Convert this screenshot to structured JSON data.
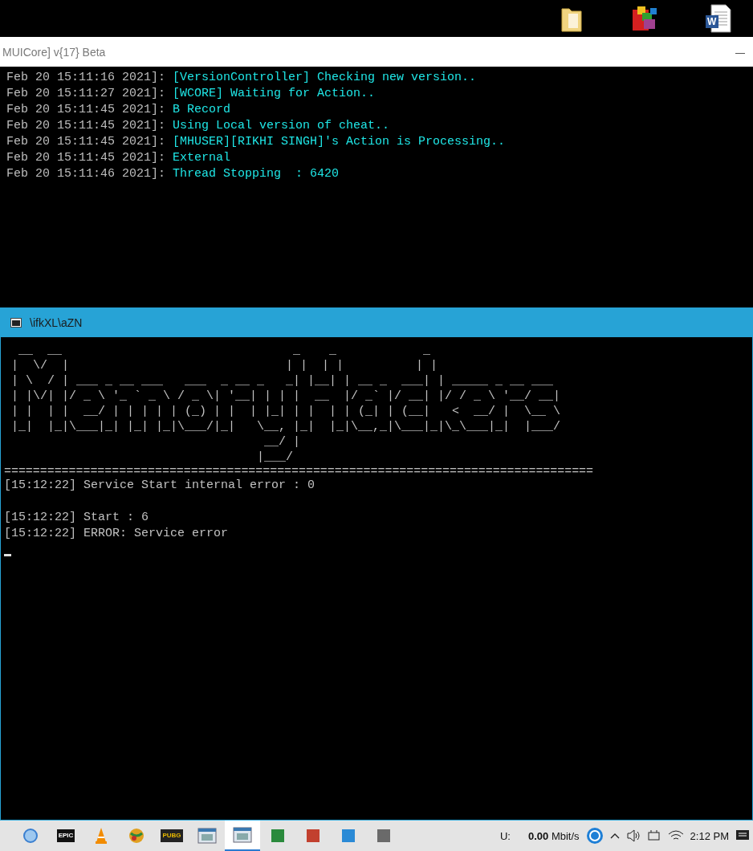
{
  "desktop_icons": [
    {
      "kind": "folder"
    },
    {
      "kind": "archive"
    },
    {
      "kind": "document",
      "letter": "W"
    }
  ],
  "log_window": {
    "title": "MUICore] v{17} Beta",
    "lines": [
      {
        "time": "Feb 20 15:11:16 2021]: ",
        "message": "[VersionController] Checking new version.."
      },
      {
        "time": "Feb 20 15:11:27 2021]: ",
        "message": "[WCORE] Waiting for Action.."
      },
      {
        "time": "Feb 20 15:11:45 2021]: ",
        "message": "B Record"
      },
      {
        "time": "Feb 20 15:11:45 2021]: ",
        "message": "Using Local version of cheat.."
      },
      {
        "time": "Feb 20 15:11:45 2021]: ",
        "message": "[MHUSER][RIKHI SINGH]'s Action is Processing.."
      },
      {
        "time": "Feb 20 15:11:45 2021]: ",
        "message": "External"
      },
      {
        "time": "Feb 20 15:11:46 2021]: ",
        "message": "Thread Stopping  : 6420"
      }
    ]
  },
  "console_window": {
    "title": "\\ifkXL\\aZN",
    "banner": [
      " __  __                                _    _            _",
      "|  \\/  |                              | |  | |          | |",
      "| \\  / | ___ _ __ ___   ___  _ __ _   _| |__| | __ _  ___| | _____ _ __ ___",
      "| |\\/| |/ _ \\ '_ ` _ \\ / _ \\| '__| | | |  __  |/ _` |/ __| |/ / _ \\ '__/ __|",
      "| |  | |  __/ | | | | | (_) | |  | |_| | |  | | (_| | (__|   <  __/ |  \\__ \\",
      "|_|  |_|\\___|_| |_| |_|\\___/|_|   \\__, |_|  |_|\\__,_|\\___|_|\\_\\___|_|  |___/",
      "                                   __/ |",
      "                                  |___/"
    ],
    "separator": "==================================================================================",
    "output_blocks": [
      [
        "[15:12:22] Service Start internal error : 0"
      ],
      [
        "[15:12:22] Start : 6",
        "[15:12:22] ERROR: Service error"
      ]
    ]
  },
  "taskbar": {
    "items": [
      {
        "kind": "circle",
        "selected": false
      },
      {
        "kind": "logo",
        "label": "EPIC",
        "selected": false
      },
      {
        "kind": "cone",
        "selected": false
      },
      {
        "kind": "ball",
        "selected": false
      },
      {
        "kind": "logo",
        "label": "PUBG",
        "selected": false
      },
      {
        "kind": "window",
        "selected": false
      },
      {
        "kind": "window",
        "selected": true
      },
      {
        "kind": "tile",
        "color": "#2a8a3c",
        "selected": false
      },
      {
        "kind": "tile",
        "color": "#c2402e",
        "selected": false
      },
      {
        "kind": "tile",
        "color": "#2a8ad6",
        "selected": false
      },
      {
        "kind": "tile",
        "color": "#6a6a6a",
        "selected": false
      }
    ],
    "network_label": "U:",
    "network_speed": "**0.00** Mbit/s",
    "clock": "2:12 PM"
  }
}
